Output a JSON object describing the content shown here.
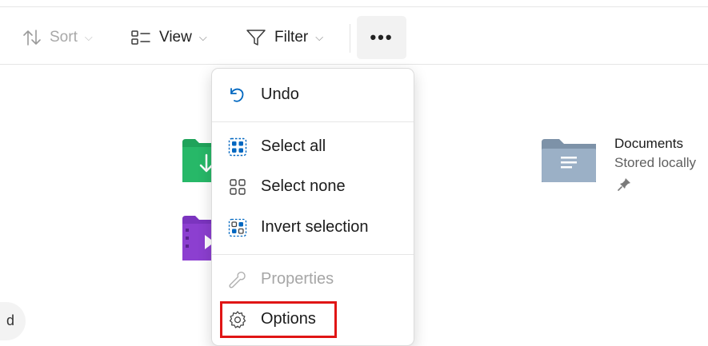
{
  "toolbar": {
    "sort": {
      "label": "Sort",
      "icon": "sort-arrows-icon",
      "disabled": true
    },
    "view": {
      "label": "View",
      "icon": "view-list-icon"
    },
    "filter": {
      "label": "Filter",
      "icon": "filter-funnel-icon"
    },
    "more": {
      "label": "•••",
      "icon": "more-options-icon"
    }
  },
  "items": {
    "documents": {
      "name": "Documents",
      "status": "Stored locally",
      "icon": "documents-folder-icon"
    },
    "downloads": {
      "icon": "downloads-folder-icon"
    },
    "videos": {
      "icon": "videos-folder-icon"
    },
    "left_partial": "d"
  },
  "menu": {
    "undo": {
      "label": "Undo",
      "icon": "undo-icon"
    },
    "select_all": {
      "label": "Select all",
      "icon": "select-all-icon"
    },
    "select_none": {
      "label": "Select none",
      "icon": "select-none-icon"
    },
    "invert_selection": {
      "label": "Invert selection",
      "icon": "invert-selection-icon"
    },
    "properties": {
      "label": "Properties",
      "icon": "wrench-icon",
      "disabled": true
    },
    "options": {
      "label": "Options",
      "icon": "gear-icon"
    }
  },
  "colors": {
    "accent": "#0067c0",
    "highlight": "#e01515",
    "downloads_folder": "#1fa35a",
    "videos_folder": "#8c3fd0",
    "documents_folder": "#8aa0b8"
  }
}
